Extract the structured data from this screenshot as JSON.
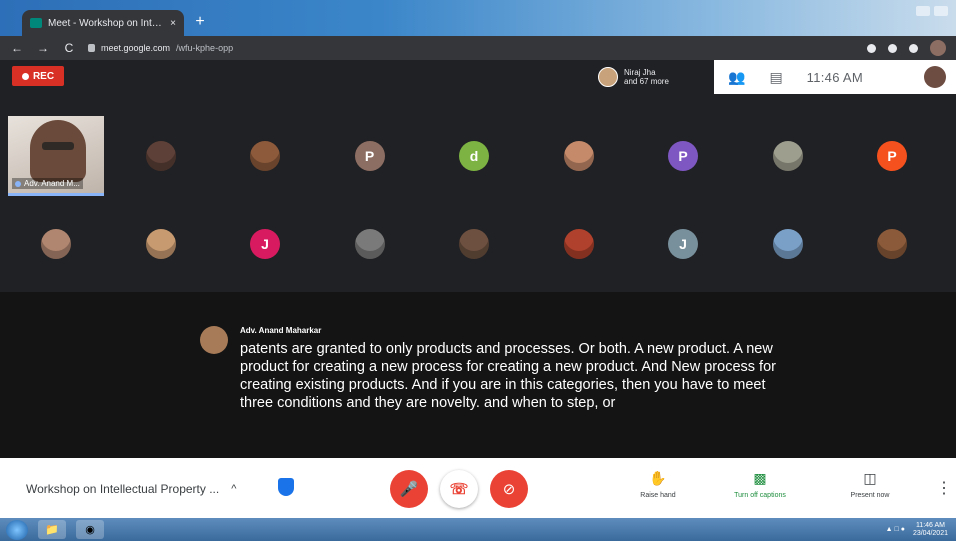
{
  "browser": {
    "tab_title": "Meet - Workshop on Intellectual Property",
    "tab_close": "×",
    "new_tab": "+",
    "url_host": "meet.google.com",
    "url_path": "/wfu-kphe-opp"
  },
  "meet_header": {
    "rec_label": "REC",
    "participants_line1": "Niraj Jha",
    "participants_line2": "and 67 more",
    "participant_count_icon": "people-icon",
    "chat_icon": "chat-icon",
    "time": "11:46 AM"
  },
  "tiles": {
    "active_name": "Adv. Anand M...",
    "avatars": [
      {
        "initial": "",
        "color": "#5d4037"
      },
      {
        "initial": "",
        "color": "#8d5a3b"
      },
      {
        "initial": "P",
        "color": "#8d6e63"
      },
      {
        "initial": "d",
        "color": "#7cb342"
      },
      {
        "initial": "",
        "color": "#c48a6a"
      },
      {
        "initial": "P",
        "color": "#7e57c2"
      },
      {
        "initial": "",
        "color": "#9e9e8e"
      },
      {
        "initial": "P",
        "color": "#f4511e"
      },
      {
        "initial": "",
        "color": "#b08670"
      },
      {
        "initial": "",
        "color": "#c79a70"
      },
      {
        "initial": "J",
        "color": "#d81b60"
      },
      {
        "initial": "",
        "color": "#7a7a7a"
      },
      {
        "initial": "",
        "color": "#6d5040"
      },
      {
        "initial": "",
        "color": "#b0412c"
      },
      {
        "initial": "J",
        "color": "#78909c"
      },
      {
        "initial": "",
        "color": "#7aa0c8"
      },
      {
        "initial": "",
        "color": "#8a5a3a"
      }
    ]
  },
  "captions": {
    "speaker": "Adv. Anand Maharkar",
    "text": "patents are granted to only products and processes. Or both. A new product. A new product for creating a new process for creating a new product. And New process for creating existing products. And if you are in this categories, then you have to meet three conditions and they are novelty. and when to step, or"
  },
  "controls": {
    "meeting_title": "Workshop on Intellectual Property ...",
    "chevron": "^",
    "raise_hand": "Raise hand",
    "turn_off_captions": "Turn off captions",
    "present_now": "Present now",
    "more": "⋮"
  },
  "taskbar": {
    "time": "11:46 AM",
    "date": "23/04/2021"
  },
  "colors": {
    "rec_red": "#d93025",
    "end_call_red": "#ea4335",
    "captions_green": "#1e8e3e",
    "meet_dark": "#202124"
  }
}
